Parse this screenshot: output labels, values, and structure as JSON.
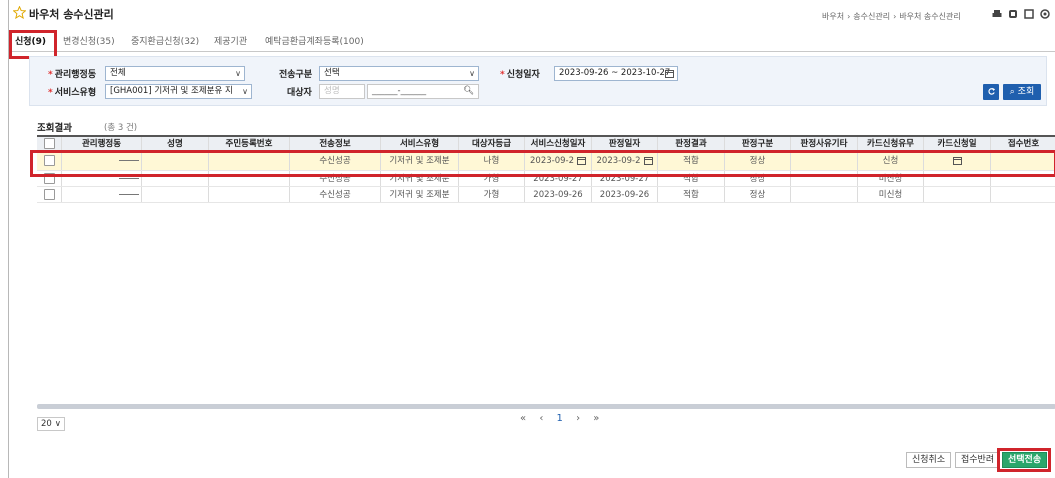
{
  "header": {
    "title": "바우처 송수신관리",
    "breadcrumb": [
      "바우처",
      "송수신관리",
      "바우처 송수신관리"
    ]
  },
  "tabs": [
    {
      "label": "신청(9)",
      "active": true
    },
    {
      "label": "변경신청(35)",
      "active": false
    },
    {
      "label": "중지환급신청(32)",
      "active": false
    },
    {
      "label": "제공기관",
      "active": false
    },
    {
      "label": "예탁금환급계좌등록(100)",
      "active": false
    }
  ],
  "search": {
    "admin_dong_label": "관리행정동",
    "admin_dong_value": "전체",
    "send_type_label": "전송구분",
    "send_type_value": "선택",
    "apply_date_label": "신청일자",
    "apply_date_value": "2023-09-26 ~ 2023-10-27",
    "service_type_label": "서비스유형",
    "service_type_value": "[GHA001] 기저귀 및 조제분유 지",
    "target_label": "대상자",
    "target_name_placeholder": "성명",
    "target_id_value": "______-______",
    "search_button": "조회"
  },
  "results": {
    "title": "조회결과",
    "count": "(총 3 건)",
    "columns": [
      "",
      "관리행정동",
      "성명",
      "주민등록번호",
      "전송정보",
      "서비스유형",
      "대상자등급",
      "서비스신청일자",
      "판정일자",
      "판정결과",
      "판정구분",
      "판정사유기타",
      "카드신청유무",
      "카드신청일",
      "접수번호"
    ],
    "rows": [
      {
        "dong": "",
        "name": "",
        "rrn": "",
        "send": "수신성공",
        "service": "기저귀 및 조제분",
        "grade": "나형",
        "apply_date": "2023-09-2",
        "judge_date": "2023-09-2",
        "result": "적합",
        "judge_type": "정상",
        "reason": "",
        "card": "신청",
        "card_date": "",
        "receipt": ""
      },
      {
        "dong": "",
        "name": "",
        "rrn": "",
        "send": "수신성공",
        "service": "기저귀 및 조제분",
        "grade": "가형",
        "apply_date": "2023-09-27",
        "judge_date": "2023-09-27",
        "result": "적합",
        "judge_type": "정상",
        "reason": "",
        "card": "미신청",
        "card_date": "",
        "receipt": ""
      },
      {
        "dong": "",
        "name": "",
        "rrn": "",
        "send": "수신성공",
        "service": "기저귀 및 조제분",
        "grade": "가형",
        "apply_date": "2023-09-26",
        "judge_date": "2023-09-26",
        "result": "적합",
        "judge_type": "정상",
        "reason": "",
        "card": "미신청",
        "card_date": "",
        "receipt": ""
      }
    ]
  },
  "pagination": {
    "page_size": "20",
    "first": "«",
    "prev": "‹",
    "current": "1",
    "next": "›",
    "last": "»"
  },
  "actions": {
    "cancel_apply": "신청취소",
    "return_receipt": "접수반려",
    "send_selected": "선택전송"
  },
  "colors": {
    "accent": "#1f5fae",
    "highlight": "#d0242b",
    "primary_button": "#2aa66b"
  }
}
